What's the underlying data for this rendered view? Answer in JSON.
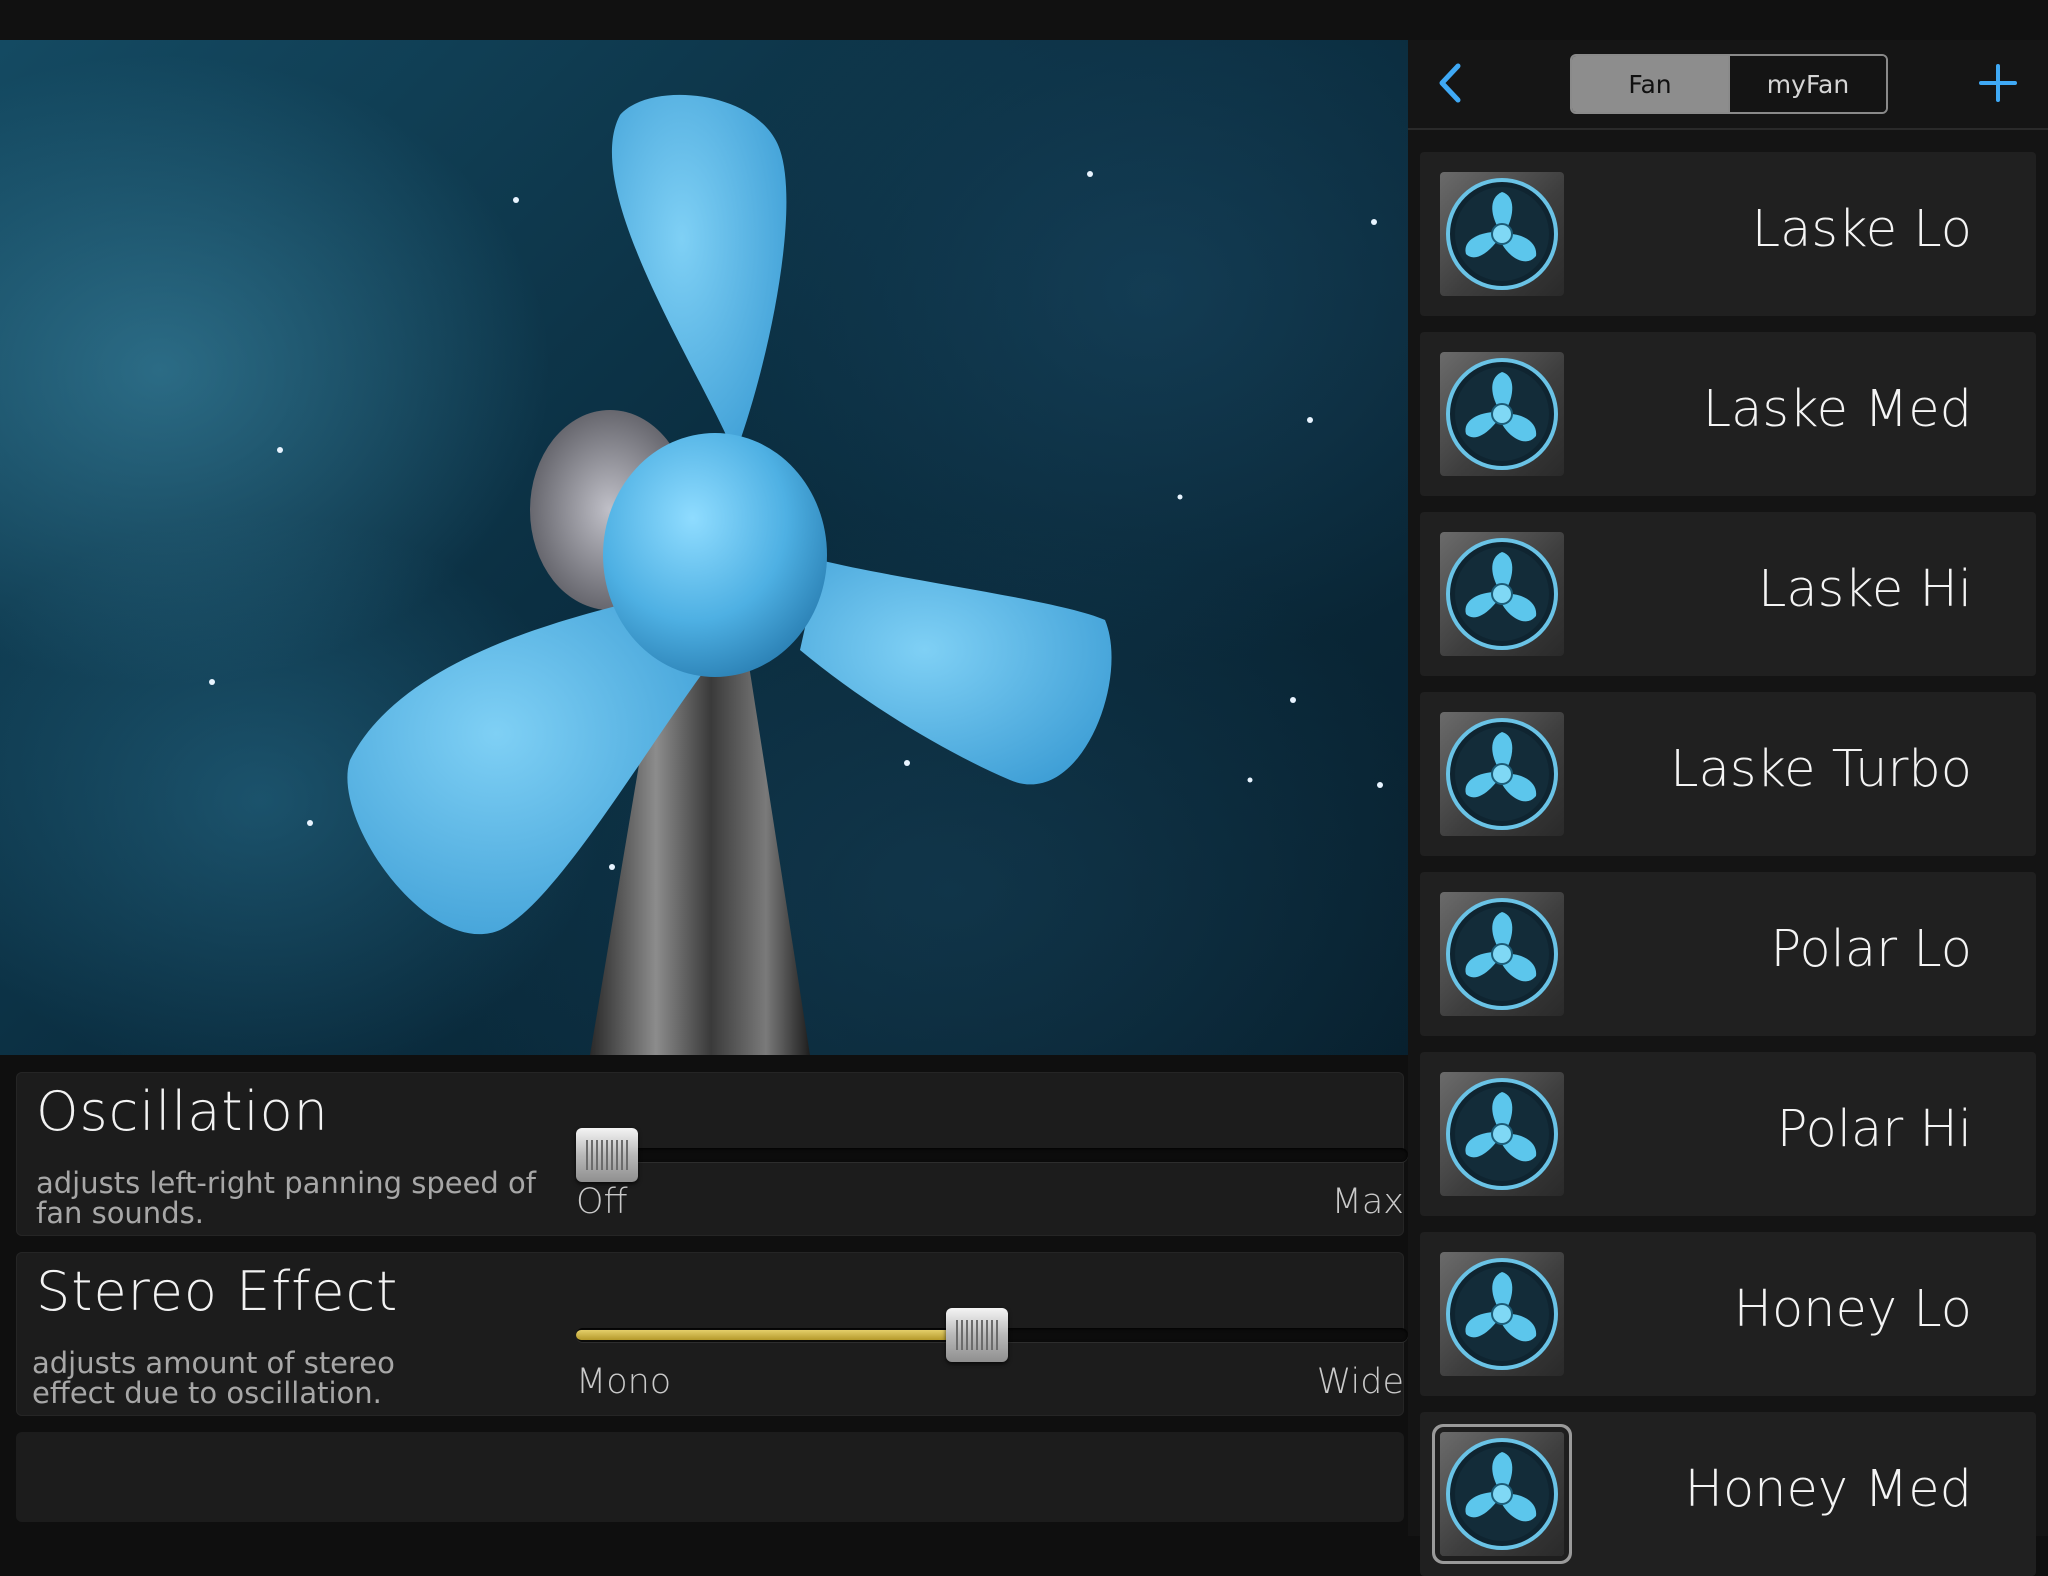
{
  "scene": {
    "title": ""
  },
  "oscillation": {
    "title": "Oscillation",
    "description": "adjusts left-right panning speed of fan sounds.",
    "min_label": "Off",
    "max_label": "Max",
    "value": 0.0
  },
  "stereo": {
    "title": "Stereo Effect",
    "description": "adjusts amount of stereo effect due to oscillation.",
    "min_label": "Mono",
    "max_label": "Wide",
    "value": 0.48
  },
  "sidebar": {
    "back_icon": "chevron-left-icon",
    "add_icon": "plus-icon",
    "tabs": [
      {
        "label": "Fan",
        "active": true
      },
      {
        "label": "myFan",
        "active": false
      }
    ],
    "presets": [
      {
        "name": "Laske Lo"
      },
      {
        "name": "Laske Med"
      },
      {
        "name": "Laske Hi"
      },
      {
        "name": "Laske Turbo"
      },
      {
        "name": "Polar Lo"
      },
      {
        "name": "Polar Hi"
      },
      {
        "name": "Honey Lo"
      },
      {
        "name": "Honey Med",
        "selected": true
      }
    ]
  },
  "colors": {
    "accent": "#3fa9f5",
    "blade": "#5bb8e6",
    "slider_fill": "#d4bb4c"
  }
}
